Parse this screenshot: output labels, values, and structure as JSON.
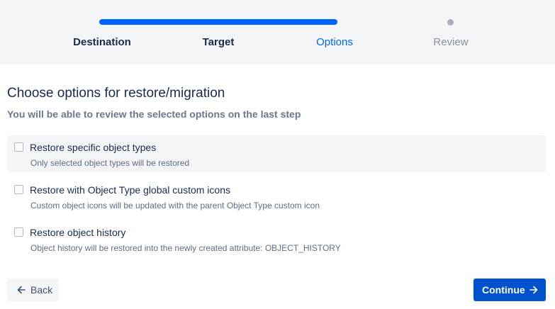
{
  "stepper": {
    "steps": [
      {
        "label": "Destination",
        "state": "done"
      },
      {
        "label": "Target",
        "state": "done"
      },
      {
        "label": "Options",
        "state": "active"
      },
      {
        "label": "Review",
        "state": "future"
      }
    ],
    "progress_color": "#0065ff",
    "future_color": "#a5adba"
  },
  "main": {
    "title": "Choose options for restore/migration",
    "subtitle": "You will be able to review the selected options on the last step",
    "options": [
      {
        "label": "Restore specific object types",
        "description": "Only selected object types will be restored",
        "checked": false
      },
      {
        "label": "Restore with Object Type global custom icons",
        "description": "Custom object icons will be updated with the parent Object Type custom icon",
        "checked": false
      },
      {
        "label": "Restore object history",
        "description": "Object history will be restored into the newly created attribute: OBJECT_HISTORY",
        "checked": false
      }
    ]
  },
  "footer": {
    "back_label": "Back",
    "back_icon": "arrow-left-icon",
    "continue_label": "Continue",
    "continue_icon": "arrow-right-icon",
    "primary_color": "#0052cc"
  }
}
